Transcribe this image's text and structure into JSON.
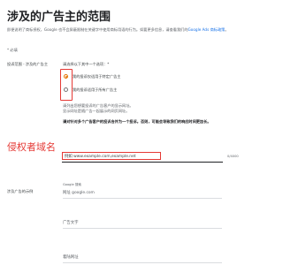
{
  "page": {
    "title": "涉及的广告主的范围",
    "intro_before": "即便说明了商标授权，Google 也不会屏蔽限制在关键字中使用商标用语的行为。如要更多信息，请查看我们的",
    "intro_link": "Google Ads 商标政策",
    "intro_after": "。",
    "required_note": "* 必填"
  },
  "scope": {
    "label": "投诉范围 - 涉及的广告主",
    "prompt": "请选择以下其中一个选项：*",
    "options": [
      {
        "label": "我的投诉仅适用于特定广告主",
        "checked": true
      },
      {
        "label": "我的投诉适用于所有广告主",
        "checked": false
      }
    ]
  },
  "hint": {
    "line1": "请列出您想要投诉的广告客户的显示网址。",
    "line2": "显示网址是随广告一起展示的网页网址。"
  },
  "bold_note": "请对针对多个广告客户的投诉合并为一个投诉。否则，可能会导致我们的响应时间更加长。",
  "overlay_label": "侵权者域名",
  "url_field": {
    "value": "例如 www.example.com,example.net",
    "counter": "0/4000"
  },
  "example": {
    "label": "涉及广告的示例",
    "google_label": "Google 搜索",
    "url_placeholder": "网址 google.com",
    "ad_text_placeholder": "广告文字",
    "landing_placeholder": "着陆网址"
  }
}
